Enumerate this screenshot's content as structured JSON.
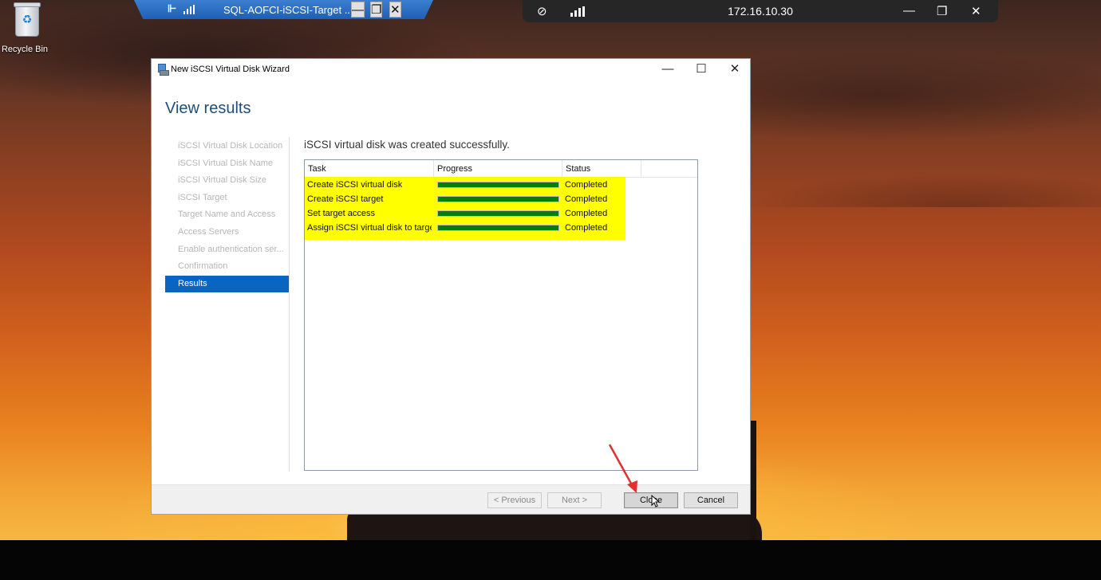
{
  "desktop": {
    "recycle_bin_label": "Recycle Bin"
  },
  "remote_bar": {
    "title": "SQL-AOFCI-iSCSI-Target ...",
    "pin_icon": "pin-icon",
    "signal_icon": "signal-bars-icon",
    "minimize_icon": "minimize-icon",
    "restore_icon": "restore-icon",
    "close_icon": "close-icon",
    "pin_glyph": "⊩",
    "minimize_glyph": "—",
    "restore_glyph": "❐",
    "close_glyph": "✕"
  },
  "connection_bar": {
    "ip": "172.16.10.30",
    "unpin_icon": "unpin-icon",
    "unpin_glyph": "⊘",
    "minimize_glyph": "—",
    "restore_glyph": "❐",
    "close_glyph": "✕"
  },
  "wizard": {
    "window_title": "New iSCSI Virtual Disk Wizard",
    "minimize_glyph": "—",
    "maximize_glyph": "☐",
    "close_glyph": "✕",
    "heading": "View results",
    "nav": [
      {
        "label": "iSCSI Virtual Disk Location",
        "active": false
      },
      {
        "label": "iSCSI Virtual Disk Name",
        "active": false
      },
      {
        "label": "iSCSI Virtual Disk Size",
        "active": false
      },
      {
        "label": "iSCSI Target",
        "active": false
      },
      {
        "label": "Target Name and Access",
        "active": false
      },
      {
        "label": "Access Servers",
        "active": false
      },
      {
        "label": "Enable authentication ser...",
        "active": false
      },
      {
        "label": "Confirmation",
        "active": false
      },
      {
        "label": "Results",
        "active": true
      }
    ],
    "message": "iSCSI virtual disk was created successfully.",
    "columns": [
      "Task",
      "Progress",
      "Status"
    ],
    "rows": [
      {
        "task": "Create iSCSI virtual disk",
        "progress": 100,
        "status": "Completed"
      },
      {
        "task": "Create iSCSI target",
        "progress": 100,
        "status": "Completed"
      },
      {
        "task": "Set target access",
        "progress": 100,
        "status": "Completed"
      },
      {
        "task": "Assign iSCSI virtual disk to target",
        "progress": 100,
        "status": "Completed"
      }
    ],
    "buttons": {
      "previous": "< Previous",
      "next": "Next >",
      "close": "Close",
      "cancel": "Cancel"
    }
  },
  "colors": {
    "accent": "#0a64c2",
    "heading": "#1e4e79",
    "highlight": "#ffff00",
    "progress_fill": "#067d06",
    "annotation_arrow": "#e03030"
  }
}
